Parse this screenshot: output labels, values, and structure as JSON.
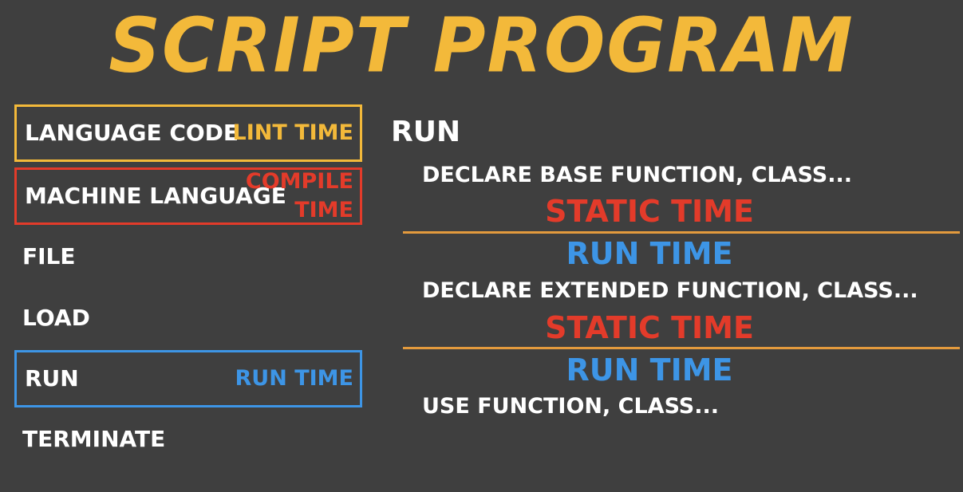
{
  "title": "SCRIPT PROGRAM",
  "colors": {
    "background": "#3f3f3f",
    "title": "#f3b93a",
    "lint": "#f3b93a",
    "compile": "#e33b2a",
    "run": "#3d95e6",
    "static": "#e33b2a",
    "divider": "#e39a3d"
  },
  "left_steps": [
    {
      "label": "LANGUAGE CODE",
      "tag": "LINT TIME"
    },
    {
      "label": "MACHINE LANGUAGE",
      "tag_line1": "COMPILE",
      "tag_line2": "TIME"
    },
    {
      "label": "FILE"
    },
    {
      "label": "LOAD"
    },
    {
      "label": "RUN",
      "tag": "RUN TIME"
    },
    {
      "label": "TERMINATE"
    }
  ],
  "right": {
    "heading": "RUN",
    "declare_base": "DECLARE BASE FUNCTION, CLASS...",
    "static_time_1": "STATIC TIME",
    "run_time_1": "RUN TIME",
    "declare_extended": "DECLARE EXTENDED FUNCTION, CLASS...",
    "static_time_2": "STATIC TIME",
    "run_time_2": "RUN TIME",
    "use_function": "USE FUNCTION, CLASS..."
  }
}
